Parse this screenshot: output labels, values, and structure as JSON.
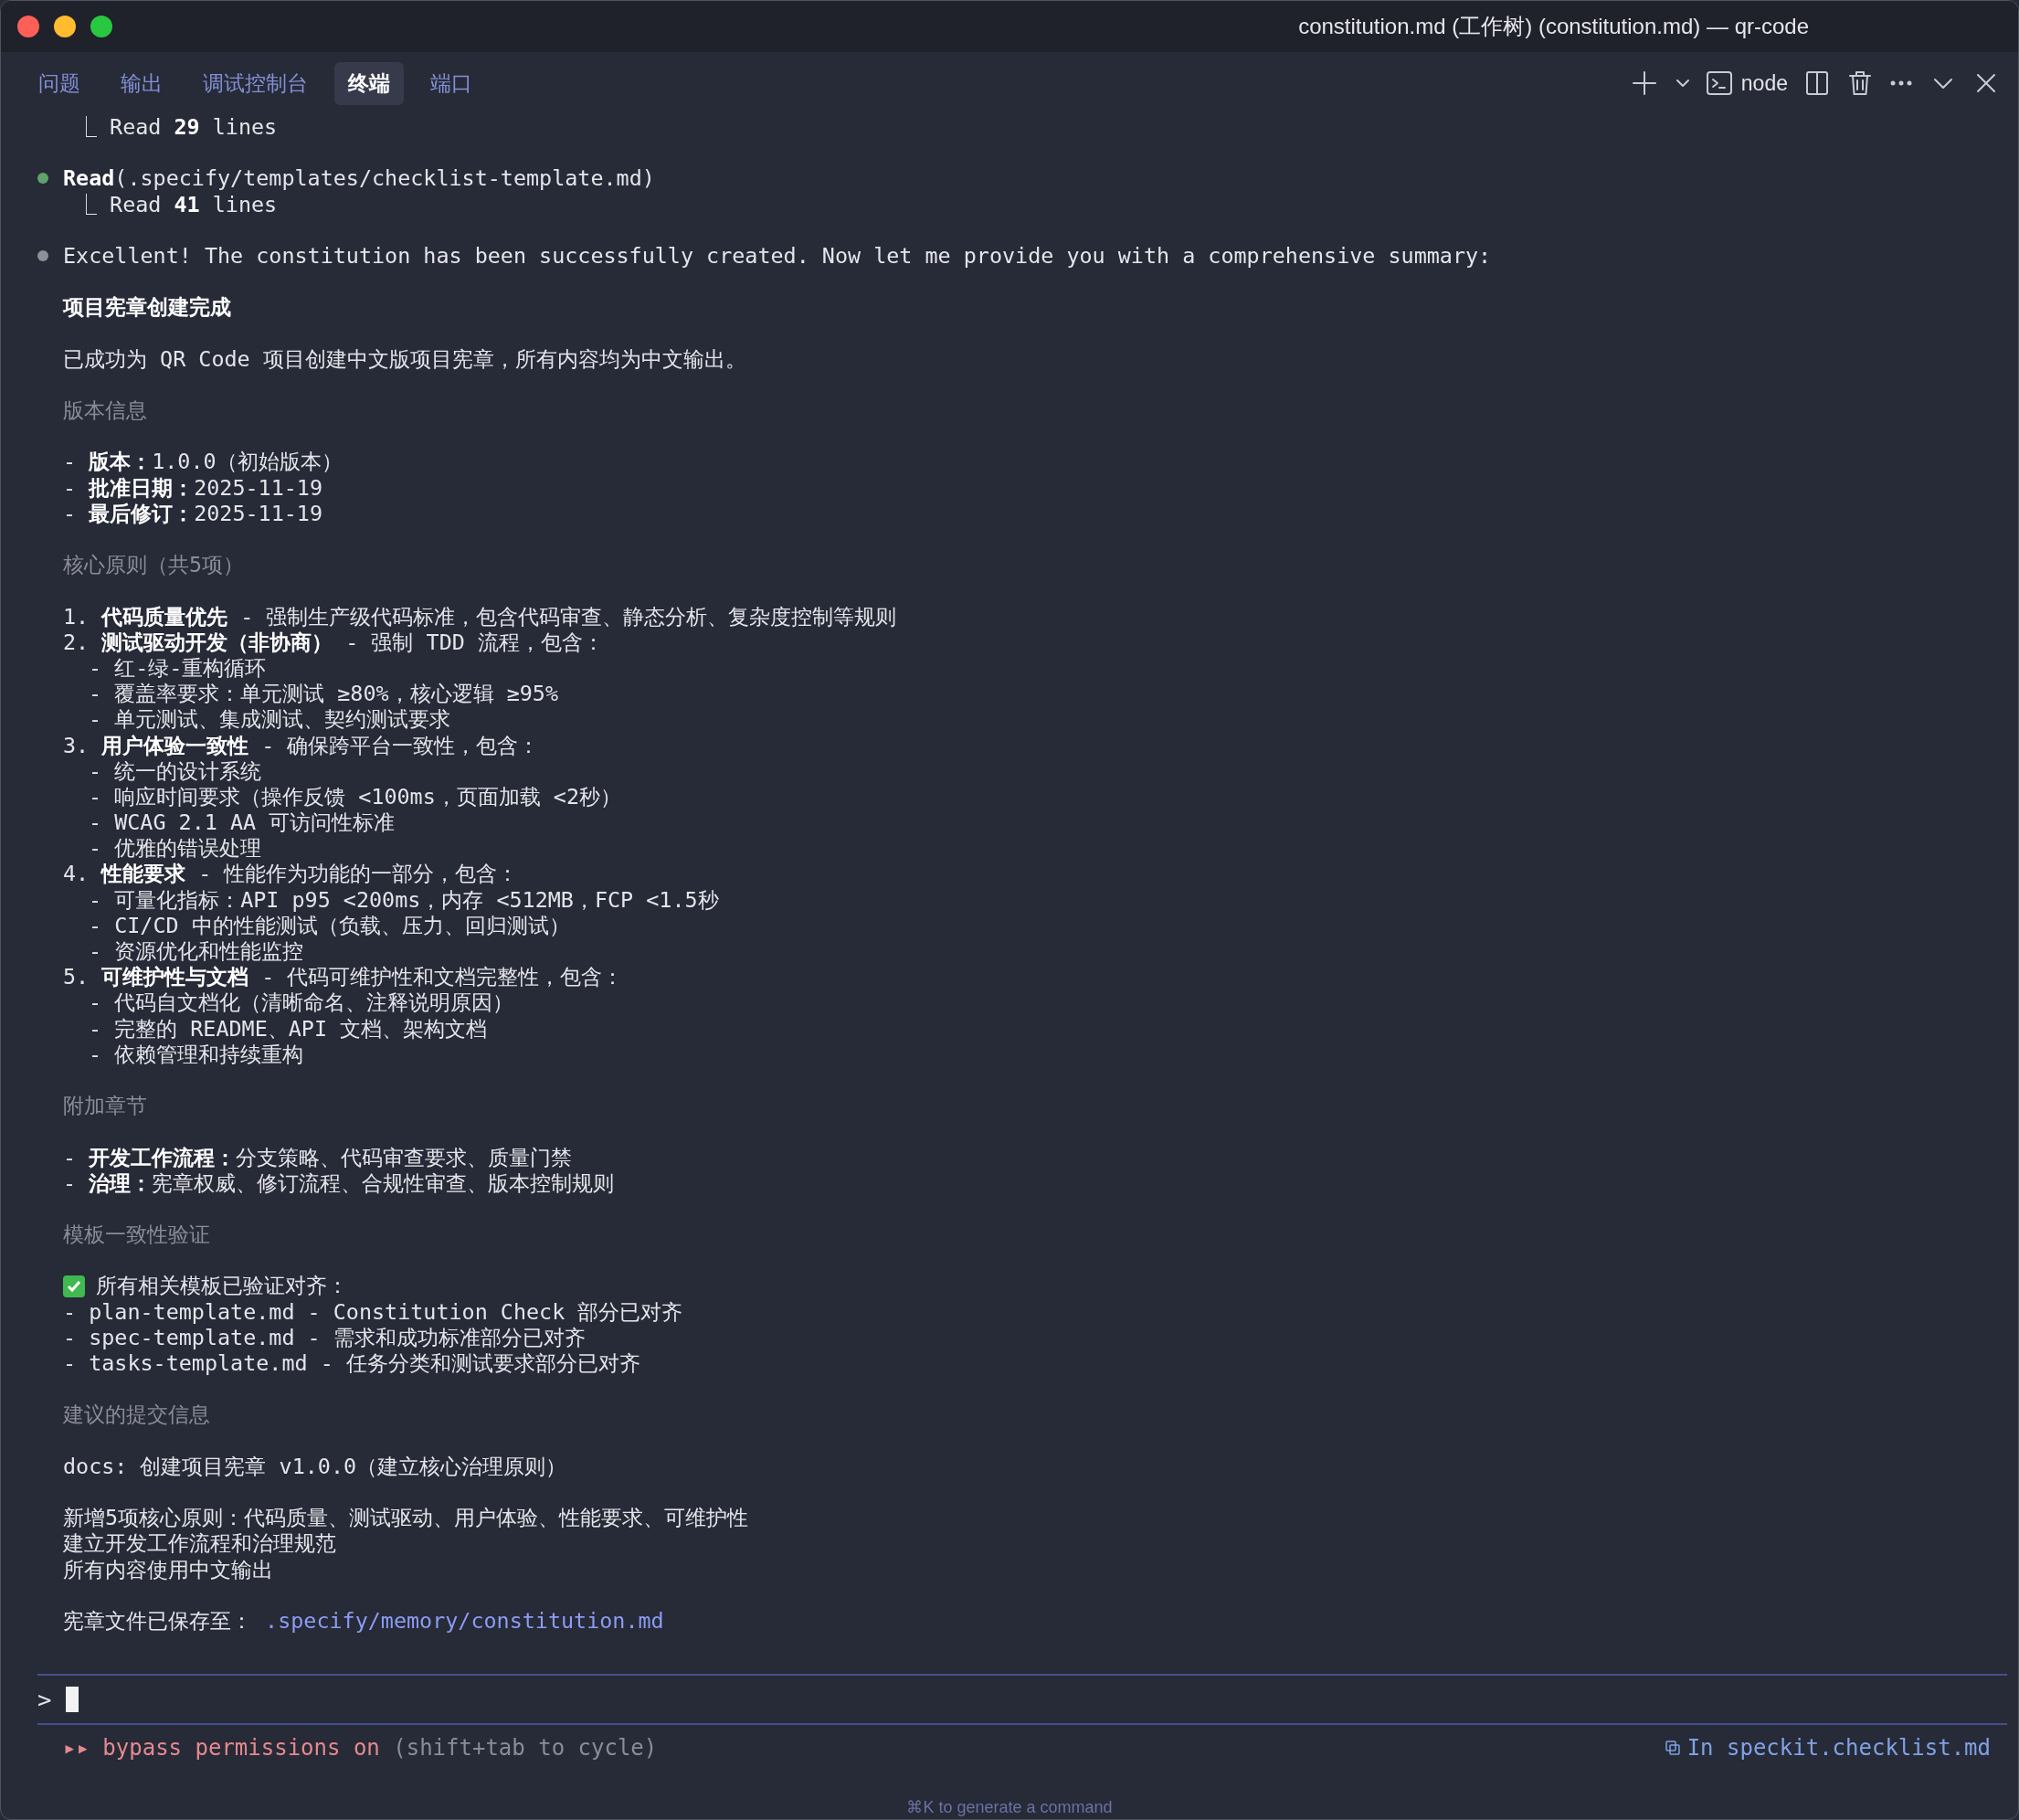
{
  "window": {
    "title": "constitution.md (工作树) (constitution.md) — qr-code"
  },
  "tabs": [
    {
      "label": "问题",
      "selected": false
    },
    {
      "label": "输出",
      "selected": false
    },
    {
      "label": "调试控制台",
      "selected": false
    },
    {
      "label": "终端",
      "selected": true
    },
    {
      "label": "端口",
      "selected": false
    }
  ],
  "toolbar": {
    "shell_label": "node"
  },
  "lines": [
    {
      "kind": "result",
      "text": "⎿ Read **29** lines"
    },
    {
      "kind": "blank"
    },
    {
      "kind": "bullet",
      "color": "#5fa36a",
      "text": "**Read**(.specify/templates/checklist-template.md)"
    },
    {
      "kind": "result",
      "text": "⎿ Read **41** lines"
    },
    {
      "kind": "blank"
    },
    {
      "kind": "bullet",
      "color": "#8e9098",
      "text": "Excellent! The constitution has been successfully created. Now let me provide you with a comprehensive summary:"
    },
    {
      "kind": "blank"
    },
    {
      "kind": "heading",
      "text": "项目宪章创建完成"
    },
    {
      "kind": "blank"
    },
    {
      "kind": "text",
      "text": "已成功为 QR Code 项目创建中文版项目宪章，所有内容均为中文输出。"
    },
    {
      "kind": "blank"
    },
    {
      "kind": "section",
      "text": "版本信息"
    },
    {
      "kind": "blank"
    },
    {
      "kind": "text",
      "text": "- **版本：**1.0.0（初始版本）"
    },
    {
      "kind": "text",
      "text": "- **批准日期：**2025-11-19"
    },
    {
      "kind": "text",
      "text": "- **最后修订：**2025-11-19"
    },
    {
      "kind": "blank"
    },
    {
      "kind": "section",
      "text": "核心原则（共5项）"
    },
    {
      "kind": "blank"
    },
    {
      "kind": "text",
      "text": "1. **代码质量优先** - 强制生产级代码标准，包含代码审查、静态分析、复杂度控制等规则"
    },
    {
      "kind": "text",
      "text": "2. **测试驱动开发（非协商）** - 强制 TDD 流程，包含："
    },
    {
      "kind": "sub",
      "text": "- 红-绿-重构循环"
    },
    {
      "kind": "sub",
      "text": "- 覆盖率要求：单元测试 ≥80%，核心逻辑 ≥95%"
    },
    {
      "kind": "sub",
      "text": "- 单元测试、集成测试、契约测试要求"
    },
    {
      "kind": "text",
      "text": "3. **用户体验一致性** - 确保跨平台一致性，包含："
    },
    {
      "kind": "sub",
      "text": "- 统一的设计系统"
    },
    {
      "kind": "sub",
      "text": "- 响应时间要求（操作反馈 <100ms，页面加载 <2秒）"
    },
    {
      "kind": "sub",
      "text": "- WCAG 2.1 AA 可访问性标准"
    },
    {
      "kind": "sub",
      "text": "- 优雅的错误处理"
    },
    {
      "kind": "text",
      "text": "4. **性能要求** - 性能作为功能的一部分，包含："
    },
    {
      "kind": "sub",
      "text": "- 可量化指标：API p95 <200ms，内存 <512MB，FCP <1.5秒"
    },
    {
      "kind": "sub",
      "text": "- CI/CD 中的性能测试（负载、压力、回归测试）"
    },
    {
      "kind": "sub",
      "text": "- 资源优化和性能监控"
    },
    {
      "kind": "text",
      "text": "5. **可维护性与文档** - 代码可维护性和文档完整性，包含："
    },
    {
      "kind": "sub",
      "text": "- 代码自文档化（清晰命名、注释说明原因）"
    },
    {
      "kind": "sub",
      "text": "- 完整的 README、API 文档、架构文档"
    },
    {
      "kind": "sub",
      "text": "- 依赖管理和持续重构"
    },
    {
      "kind": "blank"
    },
    {
      "kind": "section",
      "text": "附加章节"
    },
    {
      "kind": "blank"
    },
    {
      "kind": "text",
      "text": "- **开发工作流程：**分支策略、代码审查要求、质量门禁"
    },
    {
      "kind": "text",
      "text": "- **治理：**宪章权威、修订流程、合规性审查、版本控制规则"
    },
    {
      "kind": "blank"
    },
    {
      "kind": "section",
      "text": "模板一致性验证"
    },
    {
      "kind": "blank"
    },
    {
      "kind": "check",
      "text": "所有相关模板已验证对齐："
    },
    {
      "kind": "text",
      "text": "- plan-template.md - Constitution Check 部分已对齐"
    },
    {
      "kind": "text",
      "text": "- spec-template.md - 需求和成功标准部分已对齐"
    },
    {
      "kind": "text",
      "text": "- tasks-template.md - 任务分类和测试要求部分已对齐"
    },
    {
      "kind": "blank"
    },
    {
      "kind": "section",
      "text": "建议的提交信息"
    },
    {
      "kind": "blank"
    },
    {
      "kind": "text",
      "text": "docs: 创建项目宪章 v1.0.0（建立核心治理原则）"
    },
    {
      "kind": "blank"
    },
    {
      "kind": "text",
      "text": "新增5项核心原则：代码质量、测试驱动、用户体验、性能要求、可维护性"
    },
    {
      "kind": "text",
      "text": "建立开发工作流程和治理规范"
    },
    {
      "kind": "text",
      "text": "所有内容使用中文输出"
    },
    {
      "kind": "blank"
    },
    {
      "kind": "saved",
      "text": "宪章文件已保存至：",
      "link": ".specify/memory/constitution.md"
    }
  ],
  "prompt": {
    "symbol": ">"
  },
  "status": {
    "mode_icon": "▸▸",
    "mode": "bypass permissions on",
    "hint": "(shift+tab to cycle)",
    "context": "In speckit.checklist.md"
  },
  "footer_hint": "⌘K to generate a command"
}
